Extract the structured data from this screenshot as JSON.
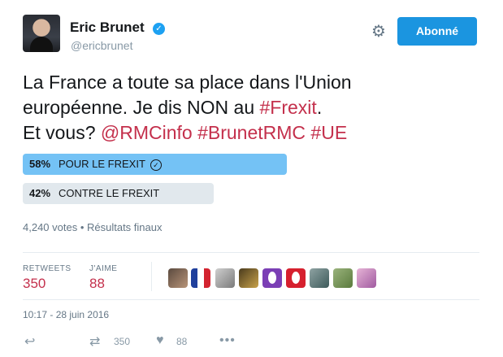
{
  "user": {
    "name": "Eric Brunet",
    "handle": "@ericbrunet",
    "follow_label": "Abonné"
  },
  "tweet": {
    "line1": "La France a toute sa place dans l'Union",
    "line2_prefix": "européenne. Je dis NON au ",
    "hashtag_frexit": "#Frexit",
    "line2_suffix": ".",
    "line3_prefix": "Et vous? ",
    "mention_rmc": "@RMCinfo",
    "hashtag_brunet": "#BrunetRMC",
    "hashtag_ue": "#UE"
  },
  "poll": {
    "options": [
      {
        "percent_label": "58%",
        "label": "POUR LE FREXIT",
        "value": 58,
        "winner": true
      },
      {
        "percent_label": "42%",
        "label": "CONTRE LE FREXIT",
        "value": 42,
        "winner": false
      }
    ],
    "summary": "4,240 votes • Résultats finaux"
  },
  "stats": {
    "retweets_label": "RETWEETS",
    "retweets_value": "350",
    "likes_label": "J'AIME",
    "likes_value": "88"
  },
  "timestamp": "10:17 - 28 juin 2016",
  "actions": {
    "retweet_count": "350",
    "like_count": "88"
  },
  "colors": {
    "accent": "#1b95e0",
    "link": "#c4304c",
    "winner_bar": "#74c2f5",
    "loser_bar": "#e1e8ed"
  },
  "icons": [
    "verified-icon",
    "gear-icon",
    "checkmark-icon",
    "reply-icon",
    "retweet-icon",
    "heart-icon",
    "more-icon"
  ]
}
